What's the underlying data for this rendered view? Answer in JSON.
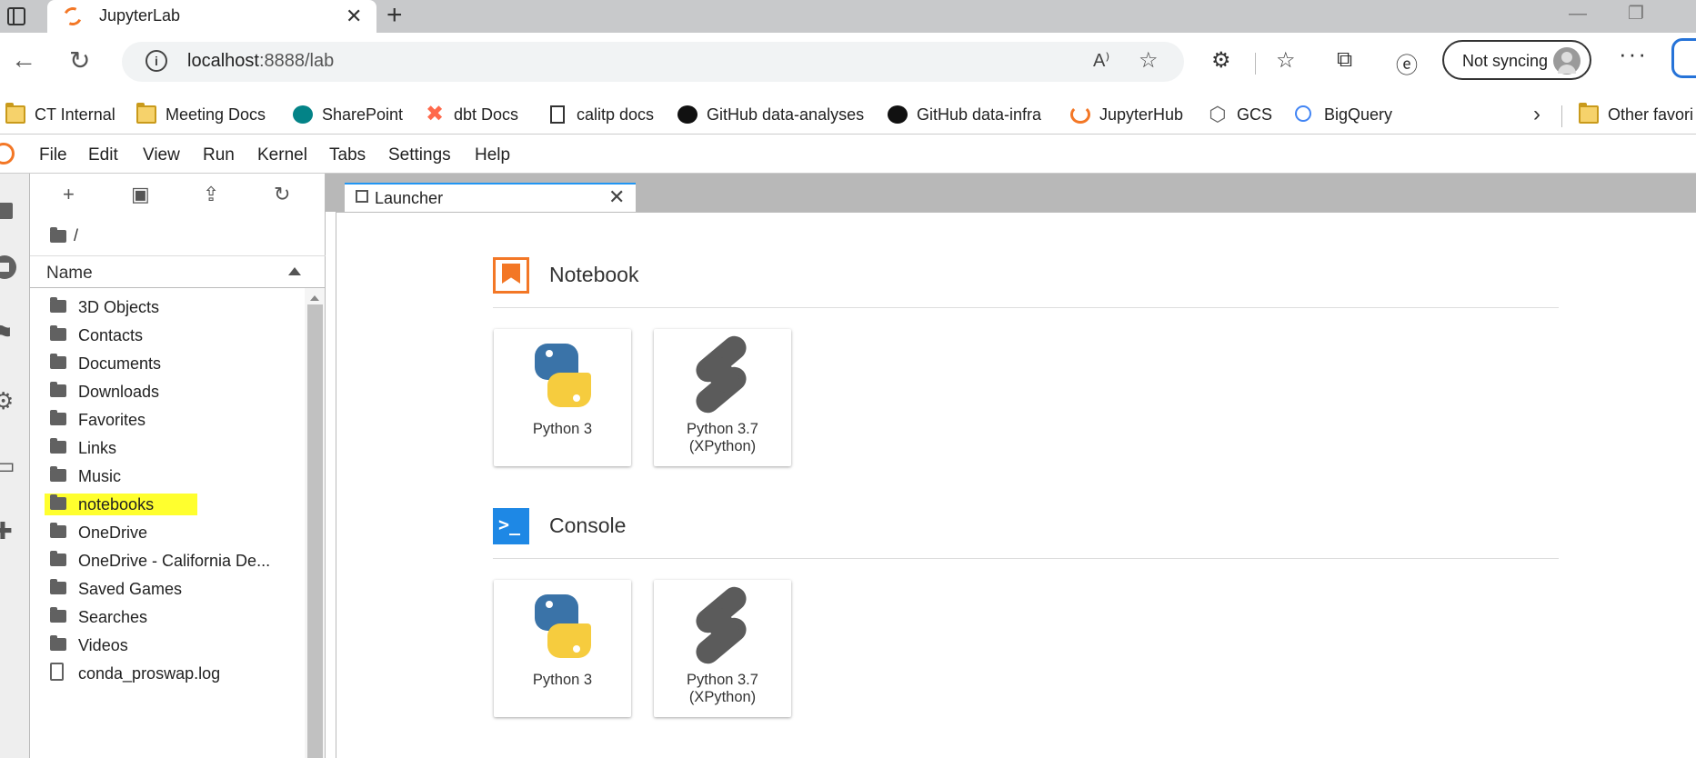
{
  "browser": {
    "tab_title": "JupyterLab",
    "url_host": "localhost",
    "url_path": ":8888/lab",
    "sync_label": "Not syncing",
    "bookmarks": [
      {
        "label": "CT Internal",
        "icon": "folder-icon"
      },
      {
        "label": "Meeting Docs",
        "icon": "folder-icon"
      },
      {
        "label": "SharePoint",
        "icon": "sharepoint-icon"
      },
      {
        "label": "dbt Docs",
        "icon": "dbt-icon"
      },
      {
        "label": "calitp docs",
        "icon": "document-icon"
      },
      {
        "label": "GitHub data-analyses",
        "icon": "github-icon"
      },
      {
        "label": "GitHub data-infra",
        "icon": "github-icon"
      },
      {
        "label": "JupyterHub",
        "icon": "jupyterhub-icon"
      },
      {
        "label": "GCS",
        "icon": "gcs-icon"
      },
      {
        "label": "BigQuery",
        "icon": "bigquery-icon"
      }
    ],
    "other_favorites": "Other favori"
  },
  "jupyter": {
    "menu": [
      "File",
      "Edit",
      "View",
      "Run",
      "Kernel",
      "Tabs",
      "Settings",
      "Help"
    ],
    "breadcrumb": "/",
    "column_name": "Name",
    "files": [
      {
        "name": "3D Objects",
        "type": "folder"
      },
      {
        "name": "Contacts",
        "type": "folder"
      },
      {
        "name": "Documents",
        "type": "folder"
      },
      {
        "name": "Downloads",
        "type": "folder"
      },
      {
        "name": "Favorites",
        "type": "folder"
      },
      {
        "name": "Links",
        "type": "folder"
      },
      {
        "name": "Music",
        "type": "folder"
      },
      {
        "name": "notebooks",
        "type": "folder",
        "highlighted": true
      },
      {
        "name": "OneDrive",
        "type": "folder"
      },
      {
        "name": "OneDrive - California De...",
        "type": "folder"
      },
      {
        "name": "Saved Games",
        "type": "folder"
      },
      {
        "name": "Searches",
        "type": "folder"
      },
      {
        "name": "Videos",
        "type": "folder"
      },
      {
        "name": "conda_proswap.log",
        "type": "file"
      }
    ],
    "launcher_tab": "Launcher",
    "sections": {
      "notebook": {
        "title": "Notebook",
        "kernels": [
          {
            "label_line1": "Python 3",
            "label_line2": ""
          },
          {
            "label_line1": "Python 3.7",
            "label_line2": "(XPython)"
          }
        ]
      },
      "console": {
        "title": "Console",
        "kernels": [
          {
            "label_line1": "Python 3",
            "label_line2": ""
          },
          {
            "label_line1": "Python 3.7",
            "label_line2": "(XPython)"
          }
        ]
      }
    }
  },
  "colors": {
    "jupyter_orange": "#f37726",
    "console_blue": "#1e88e5",
    "highlight_yellow": "#ffff2e",
    "active_tab_border": "#2196f3"
  }
}
